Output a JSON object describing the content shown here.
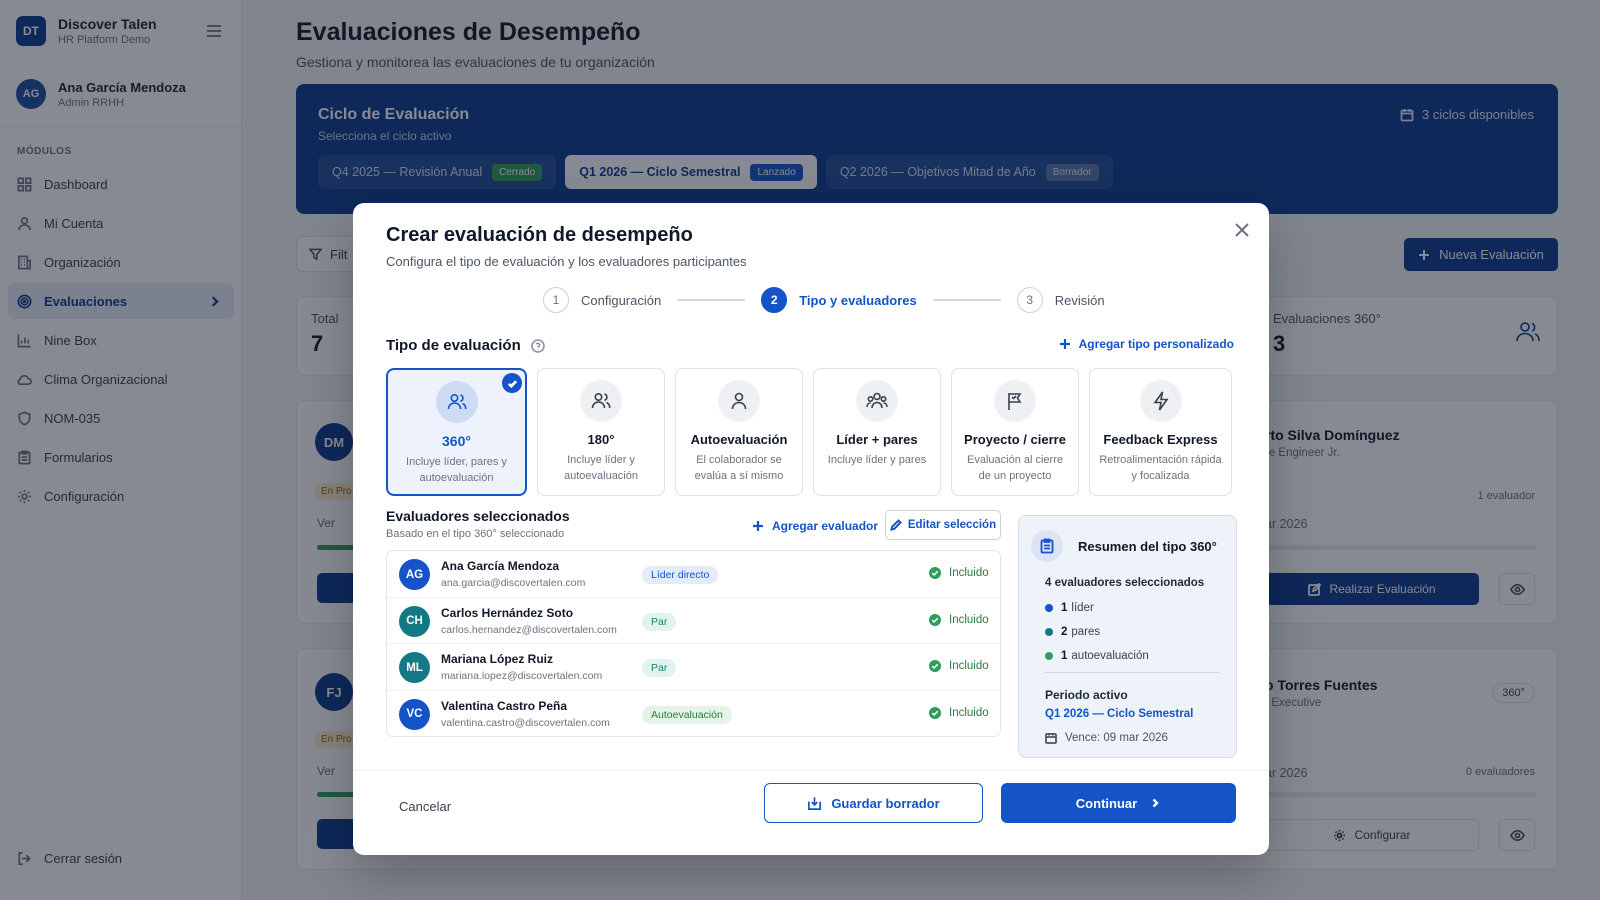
{
  "brand": {
    "logo": "DT",
    "name": "Discover Talen",
    "subtitle": "HR Platform Demo"
  },
  "user": {
    "initials": "AG",
    "name": "Ana García Mendoza",
    "role": "Admin RRHH"
  },
  "sidebar": {
    "section_label": "MÓDULOS",
    "items": [
      {
        "label": "Dashboard",
        "icon": "dashboard-icon"
      },
      {
        "label": "Mi Cuenta",
        "icon": "user-icon"
      },
      {
        "label": "Organización",
        "icon": "building-icon"
      },
      {
        "label": "Evaluaciones",
        "icon": "target-icon",
        "active": true
      },
      {
        "label": "Nine Box",
        "icon": "bar-chart-icon"
      },
      {
        "label": "Clima Organizacional",
        "icon": "cloud-icon"
      },
      {
        "label": "NOM-035",
        "icon": "shield-icon"
      },
      {
        "label": "Formularios",
        "icon": "clipboard-icon"
      },
      {
        "label": "Configuración",
        "icon": "gear-icon"
      }
    ],
    "logout": "Cerrar sesión"
  },
  "main": {
    "title": "Evaluaciones de Desempeño",
    "subtitle": "Gestiona y monitorea las evaluaciones de tu organización",
    "cycle": {
      "title": "Ciclo de Evaluación",
      "subtitle": "Selecciona el ciclo activo",
      "available": "3 ciclos disponibles",
      "tabs": [
        {
          "label": "Q4 2025 — Revisión Anual",
          "tag": "Cerrado"
        },
        {
          "label": "Q1 2026 — Ciclo Semestral",
          "tag": "Lanzado"
        },
        {
          "label": "Q2 2026 — Objetivos Mitad de Año",
          "tag": "Borrador"
        }
      ]
    },
    "filter_label": "Filt",
    "new_button": "Nueva Evaluación",
    "stats": {
      "total_label": "Total",
      "total_value": "7",
      "threesixty_label": "Evaluaciones 360°",
      "threesixty_value": "3"
    },
    "cards": [
      {
        "initials": "DM",
        "status": "En Pro",
        "ver": "Ver",
        "name": "rto Silva Domínguez",
        "role": "re Engineer Jr.",
        "evaluators": "1 evaluador",
        "date": "ar 2026",
        "action": "Realizar Evaluación"
      },
      {
        "initials": "FJ",
        "status": "En Pro",
        "ver": "Ver",
        "name": "o Torres Fuentes",
        "role": "t Executive",
        "type": "360°",
        "evaluators": "0 evaluadores",
        "date": "ar 2026",
        "action": "Configurar"
      }
    ]
  },
  "modal": {
    "title": "Crear evaluación de desempeño",
    "subtitle": "Configura el tipo de evaluación y los evaluadores participantes",
    "steps": [
      {
        "num": "1",
        "label": "Configuración"
      },
      {
        "num": "2",
        "label": "Tipo y evaluadores"
      },
      {
        "num": "3",
        "label": "Revisión"
      }
    ],
    "type_section": "Tipo de evaluación",
    "add_type": "Agregar tipo personalizado",
    "types": [
      {
        "title": "360°",
        "desc": "Incluye líder, pares y autoevaluación",
        "icon": "users-icon",
        "selected": true
      },
      {
        "title": "180°",
        "desc": "Incluye líder y autoevaluación",
        "icon": "two-users-icon"
      },
      {
        "title": "Autoevaluación",
        "desc": "El colaborador se evalúa a sí mismo",
        "icon": "user-icon"
      },
      {
        "title": "Líder + pares",
        "desc": "Incluye líder y pares",
        "icon": "group-icon"
      },
      {
        "title": "Proyecto / cierre",
        "desc": "Evaluación al cierre de un proyecto",
        "icon": "flag-icon"
      },
      {
        "title": "Feedback Express",
        "desc": "Retroalimentación rápida y focalizada",
        "icon": "bolt-icon"
      }
    ],
    "evaluators_title": "Evaluadores seleccionados",
    "evaluators_sub": "Basado en el tipo 360° seleccionado",
    "add_evaluator": "Agregar evaluador",
    "edit_selection": "Editar selección",
    "evaluators": [
      {
        "initials": "AG",
        "name": "Ana García Mendoza",
        "email": "ana.garcia@discovertalen.com",
        "role": "Líder directo",
        "status": "Incluido",
        "color": "#1554c7"
      },
      {
        "initials": "CH",
        "name": "Carlos Hernández Soto",
        "email": "carlos.hernandez@discovertalen.com",
        "role": "Par",
        "status": "Incluido",
        "color": "#137a85"
      },
      {
        "initials": "ML",
        "name": "Mariana López Ruiz",
        "email": "mariana.lopez@discovertalen.com",
        "role": "Par",
        "status": "Incluido",
        "color": "#137a85"
      },
      {
        "initials": "VC",
        "name": "Valentina Castro Peña",
        "email": "valentina.castro@discovertalen.com",
        "role": "Autoevaluación",
        "status": "Incluido",
        "color": "#1554c7"
      }
    ],
    "summary": {
      "title": "Resumen del tipo 360°",
      "count": "4 evaluadores seleccionados",
      "items": [
        {
          "num": "1",
          "label": "líder",
          "color": "#1554c7"
        },
        {
          "num": "2",
          "label": "pares",
          "color": "#137a85"
        },
        {
          "num": "1",
          "label": "autoevaluación",
          "color": "#2f9d5b"
        }
      ],
      "period_label": "Periodo activo",
      "period_value": "Q1 2026 — Ciclo Semestral",
      "due": "Vence: 09 mar 2026"
    },
    "cancel": "Cancelar",
    "save_draft": "Guardar borrador",
    "continue": "Continuar"
  }
}
